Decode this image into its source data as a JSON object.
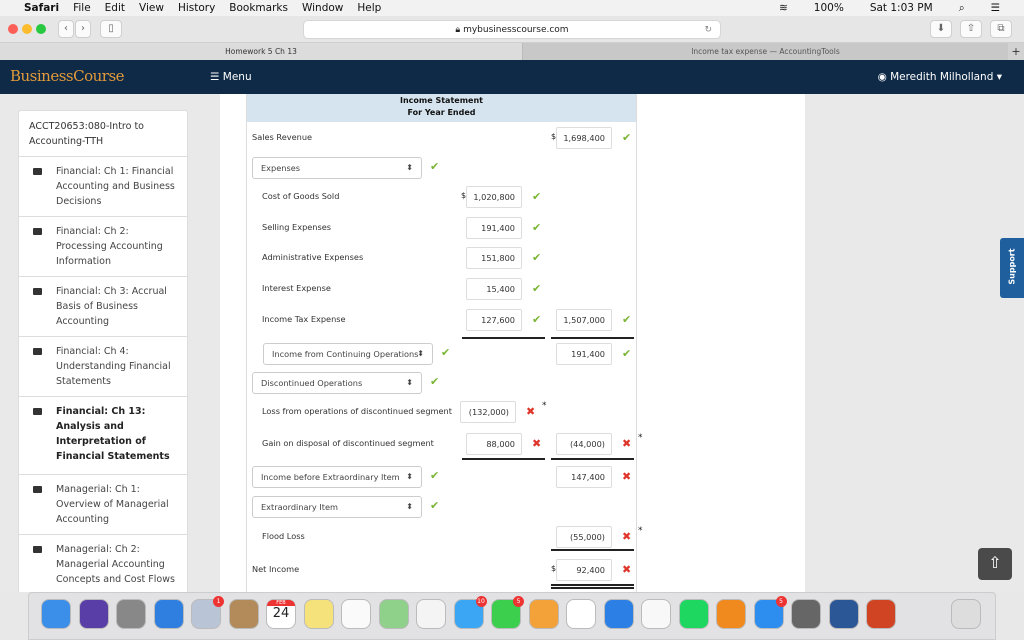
{
  "menubar": {
    "app": "Safari",
    "items": [
      "File",
      "Edit",
      "View",
      "History",
      "Bookmarks",
      "Window",
      "Help"
    ],
    "battery": "100%",
    "clock": "Sat 1:03 PM"
  },
  "browser": {
    "url": "mybusinesscourse.com",
    "tabs": [
      "Homework 5 Ch 13",
      "Income tax expense — AccountingTools"
    ],
    "new_tab": "+"
  },
  "nav": {
    "logo": "BusinessCourse",
    "menu": "Menu",
    "user": "Meredith Milholland"
  },
  "sidebar": {
    "course": "ACCT20653:080-Intro to Accounting-TTH",
    "items": [
      {
        "label": "Financial: Ch 1: Financial Accounting and Business Decisions",
        "active": false
      },
      {
        "label": "Financial: Ch 2: Processing Accounting Information",
        "active": false
      },
      {
        "label": "Financial: Ch 3: Accrual Basis of Business Accounting",
        "active": false
      },
      {
        "label": "Financial: Ch 4: Understanding Financial Statements",
        "active": false
      },
      {
        "label": "Financial: Ch 13: Analysis and Interpretation of Financial Statements",
        "active": true
      },
      {
        "label": "Managerial: Ch 1: Overview of Managerial Accounting",
        "active": false
      },
      {
        "label": "Managerial: Ch 2: Managerial Accounting Concepts and Cost Flows",
        "active": false
      }
    ]
  },
  "statement": {
    "title": "Income Statement",
    "subtitle": "For Year Ended",
    "currency": "$",
    "rows": [
      {
        "type": "label",
        "label": "Sales Revenue",
        "col2": "1,698,400",
        "col2_dollar": true,
        "col2_status": "correct"
      },
      {
        "type": "select",
        "label": "Expenses",
        "status": "correct"
      },
      {
        "type": "label",
        "indent": true,
        "label": "Cost of Goods Sold",
        "col1": "1,020,800",
        "col1_dollar": true,
        "col1_status": "correct"
      },
      {
        "type": "label",
        "indent": true,
        "label": "Selling Expenses",
        "col1": "191,400",
        "col1_status": "correct"
      },
      {
        "type": "label",
        "indent": true,
        "label": "Administrative Expenses",
        "col1": "151,800",
        "col1_status": "correct"
      },
      {
        "type": "label",
        "indent": true,
        "label": "Interest Expense",
        "col1": "15,400",
        "col1_status": "correct"
      },
      {
        "type": "label",
        "indent": true,
        "label": "Income Tax Expense",
        "col1": "127,600",
        "col1_status": "correct",
        "col2": "1,507,000",
        "col2_status": "correct"
      },
      {
        "type": "select",
        "indent": true,
        "label": "Income from Continuing Operations",
        "status": "correct",
        "col2": "191,400",
        "col2_status": "correct"
      },
      {
        "type": "select",
        "label": "Discontinued Operations",
        "status": "correct"
      },
      {
        "type": "label",
        "indent": true,
        "label": "Loss from operations of discontinued segment",
        "col1": "(132,000)",
        "col1_status": "incorrect",
        "col1_star": "*"
      },
      {
        "type": "label",
        "indent": true,
        "label": "Gain on disposal of discontinued segment",
        "col1": "88,000",
        "col1_status": "incorrect",
        "col2": "(44,000)",
        "col2_status": "incorrect",
        "col2_star": "*"
      },
      {
        "type": "select",
        "label": "Income before Extraordinary Item",
        "status": "correct",
        "col2": "147,400",
        "col2_status": "incorrect"
      },
      {
        "type": "select",
        "label": "Extraordinary Item",
        "status": "correct"
      },
      {
        "type": "label",
        "indent": true,
        "label": "Flood Loss",
        "col2": "(55,000)",
        "col2_status": "incorrect",
        "col2_star": "*"
      },
      {
        "type": "label",
        "label": "Net Income",
        "col2": "92,400",
        "col2_dollar": true,
        "col2_status": "incorrect"
      }
    ],
    "status_icons": {
      "correct": "✔",
      "incorrect": "✖"
    },
    "colors": {
      "correct": "#7ab532",
      "incorrect": "#e0352b"
    }
  },
  "support": "Support",
  "dock": {
    "badges": {
      "mail": "1",
      "messages": "10",
      "facetime": "5",
      "appstore": "5"
    },
    "calendar": {
      "month": "FEB",
      "day": "24"
    }
  }
}
